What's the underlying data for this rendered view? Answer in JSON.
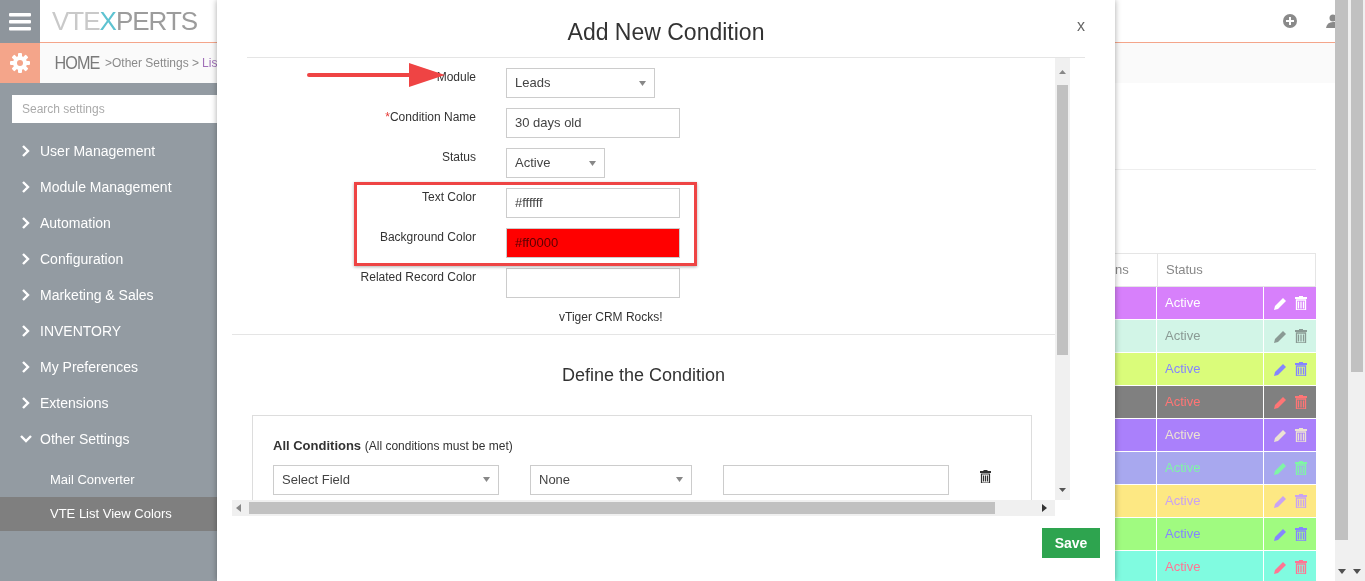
{
  "header": {
    "logo": [
      {
        "text": "VTE",
        "color": "#c9c9c9"
      },
      {
        "text": "X",
        "color": "#5ec3d1"
      },
      {
        "text": "PERTS",
        "color": "#9c9c9c"
      }
    ],
    "breadcrumb": [
      {
        "text": "HOME",
        "kind": "home"
      },
      {
        "text": ">Other Settings >",
        "kind": "link"
      },
      {
        "text": "Lis",
        "kind": "current"
      }
    ]
  },
  "sidebar": {
    "search_placeholder": "Search settings",
    "items": [
      {
        "label": "User Management",
        "expanded": false
      },
      {
        "label": "Module Management",
        "expanded": false
      },
      {
        "label": "Automation",
        "expanded": false
      },
      {
        "label": "Configuration",
        "expanded": false
      },
      {
        "label": "Marketing & Sales",
        "expanded": false
      },
      {
        "label": "INVENTORY",
        "expanded": false
      },
      {
        "label": "My Preferences",
        "expanded": false
      },
      {
        "label": "Extensions",
        "expanded": false
      },
      {
        "label": "Other Settings",
        "expanded": true,
        "children": [
          {
            "label": "Mail Converter",
            "selected": false
          },
          {
            "label": "VTE List View Colors",
            "selected": true
          }
        ]
      }
    ]
  },
  "background_table": {
    "columns": [
      "ns",
      "Status"
    ],
    "rows": [
      {
        "color": "#d780fb",
        "status": {
          "text": "Active",
          "color": "#ffffff"
        }
      },
      {
        "color": "#d2f5e7",
        "status": {
          "text": "Active",
          "color": "#8a9a94"
        }
      },
      {
        "color": "#dafc7a",
        "status": {
          "text": "Active",
          "color": "#8585ff"
        }
      },
      {
        "color": "#808080",
        "status": {
          "text": "Active",
          "color": "#ff7575"
        }
      },
      {
        "color": "#aa80fb",
        "status": {
          "text": "Active",
          "color": "#ece2d2"
        }
      },
      {
        "color": "#a8a8ef",
        "status": {
          "text": "Active",
          "color": "#7ff5a6"
        }
      },
      {
        "color": "#fde883",
        "status": {
          "text": "Active",
          "color": "#c9a3f2"
        }
      },
      {
        "color": "#a0fb80",
        "status": {
          "text": "Active",
          "color": "#8585ff"
        }
      },
      {
        "color": "#80fbe0",
        "status": {
          "text": "Active",
          "color": "#ff7593"
        }
      }
    ]
  },
  "dialog": {
    "title": "Add New Condition",
    "close": "x",
    "fields": [
      {
        "kind": "select",
        "label": "Module",
        "value": "Leads",
        "pointed_at": true,
        "highlighted": false
      },
      {
        "kind": "input",
        "label": "Condition Name",
        "required_mark": "*",
        "value": "30 days old",
        "pointed_at": false,
        "highlighted": false
      },
      {
        "kind": "select",
        "label": "Status",
        "value": "Active",
        "pointed_at": false,
        "highlighted": false
      },
      {
        "kind": "input",
        "label": "Text Color",
        "value": "#ffffff",
        "pointed_at": false,
        "highlighted": true
      },
      {
        "kind": "color",
        "label": "Background Color",
        "value": "#ff0000",
        "color": "#ff0000",
        "pointed_at": false,
        "highlighted": true
      },
      {
        "kind": "input",
        "label": "Related Record Color",
        "pointed_at": false,
        "highlighted": false
      }
    ],
    "preview": "vTiger CRM Rocks!",
    "condition_title": "Define the Condition",
    "group": {
      "title": "All Conditions",
      "note": "(All conditions must be met)",
      "field": "Select Field",
      "operator": "None"
    },
    "save": "Save"
  }
}
